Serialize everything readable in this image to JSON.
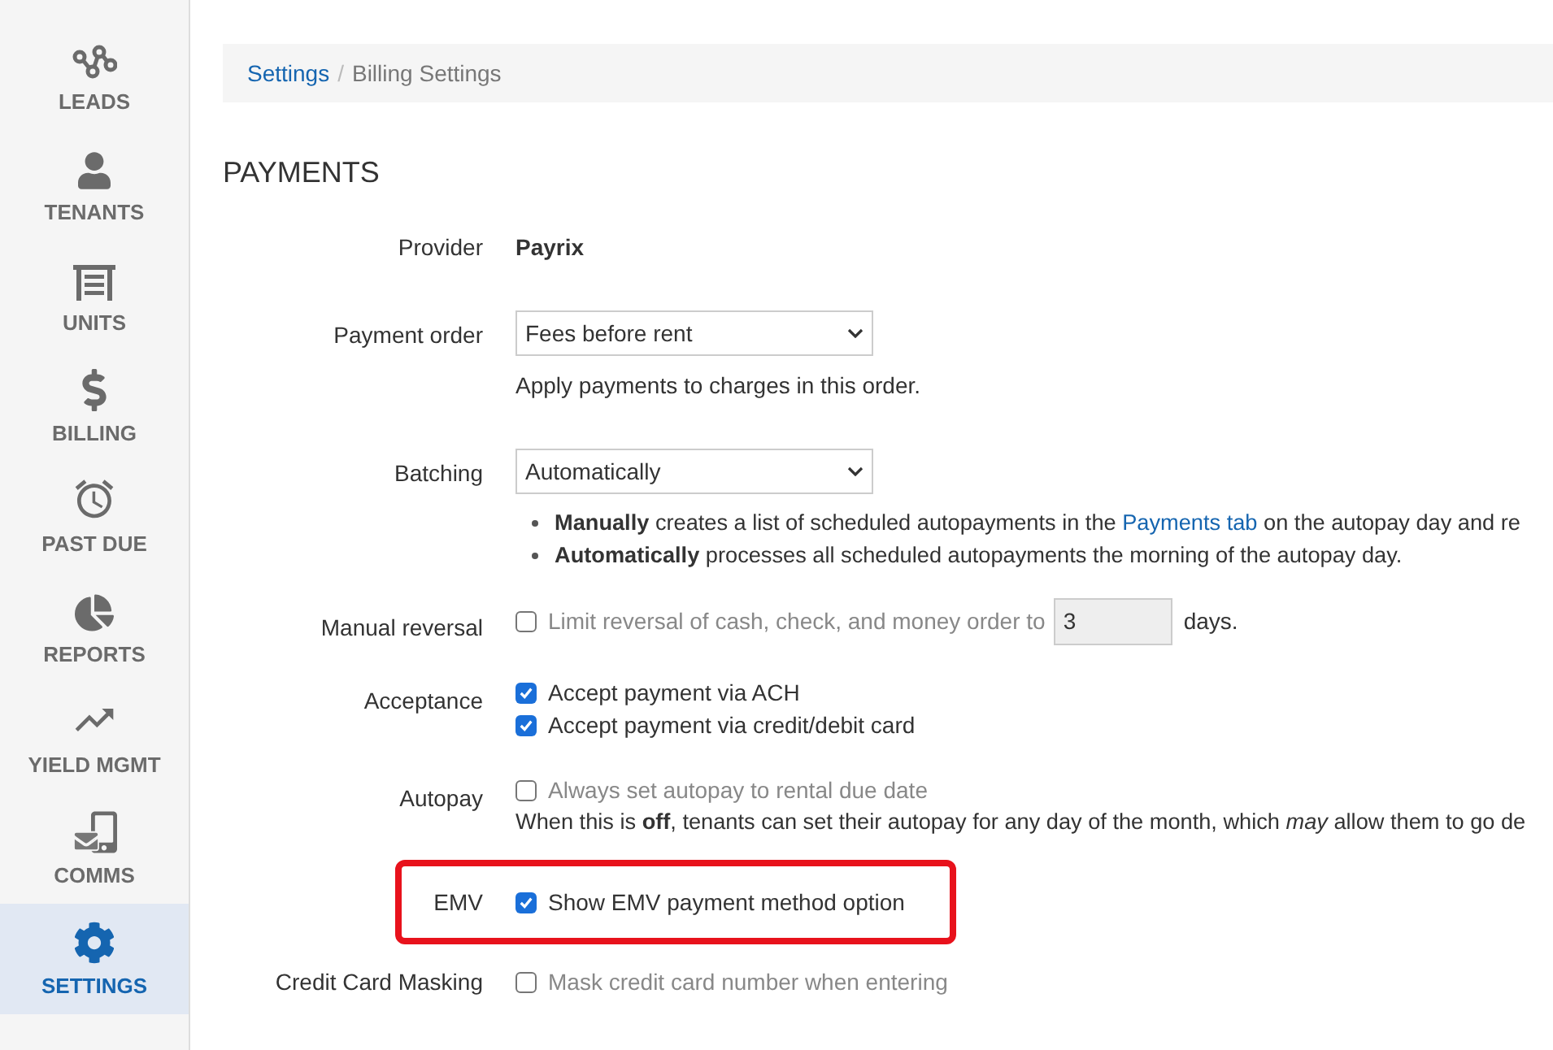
{
  "sidebar": {
    "items": [
      {
        "label": "LEADS",
        "selected": false
      },
      {
        "label": "TENANTS",
        "selected": false
      },
      {
        "label": "UNITS",
        "selected": false
      },
      {
        "label": "BILLING",
        "selected": false
      },
      {
        "label": "PAST DUE",
        "selected": false
      },
      {
        "label": "REPORTS",
        "selected": false
      },
      {
        "label": "YIELD MGMT",
        "selected": false
      },
      {
        "label": "COMMS",
        "selected": false
      },
      {
        "label": "SETTINGS",
        "selected": true
      }
    ]
  },
  "breadcrumb": {
    "link": "Settings",
    "separator": "/",
    "current": "Billing Settings"
  },
  "section_title": "PAYMENTS",
  "rows": [
    {
      "kind": "value",
      "label": "Provider",
      "value": "Payrix"
    },
    {
      "kind": "select",
      "label": "Payment order",
      "value": "Fees before rent",
      "help": "Apply payments to charges in this order."
    },
    {
      "kind": "select",
      "label": "Batching",
      "value": "Automatically",
      "bullets": [
        {
          "text": "**Manually** creates a list of scheduled autopayments in the",
          "link": "Payments tab",
          "after": "on the autopay day and re"
        },
        {
          "text": "**Automatically** processes all scheduled autopayments the morning of the autopay day."
        }
      ]
    },
    {
      "kind": "options",
      "label": "Manual reversal",
      "highlighted": false,
      "options": [
        {
          "text": "Limit reversal of cash, check, and money order to",
          "checked": false,
          "input": "3",
          "after": "days."
        }
      ]
    },
    {
      "kind": "options",
      "label": "Acceptance",
      "highlighted": false,
      "options": [
        {
          "text": "Accept payment via ACH",
          "checked": true
        },
        {
          "text": "Accept payment via credit/debit card",
          "checked": true
        }
      ]
    },
    {
      "kind": "options",
      "label": "Autopay",
      "highlighted": false,
      "options": [
        {
          "text": "Always set autopay to rental due date",
          "checked": false
        }
      ],
      "note": "When this is **off**, tenants can set their autopay for any day of the month, which *may* allow them to go de"
    },
    {
      "kind": "options",
      "label": "EMV",
      "highlighted": true,
      "options": [
        {
          "text": "Show EMV payment method option",
          "checked": true
        }
      ]
    },
    {
      "kind": "options",
      "label": "Credit Card Masking",
      "highlighted": false,
      "options": [
        {
          "text": "Mask credit card number when entering",
          "checked": false
        }
      ]
    }
  ]
}
